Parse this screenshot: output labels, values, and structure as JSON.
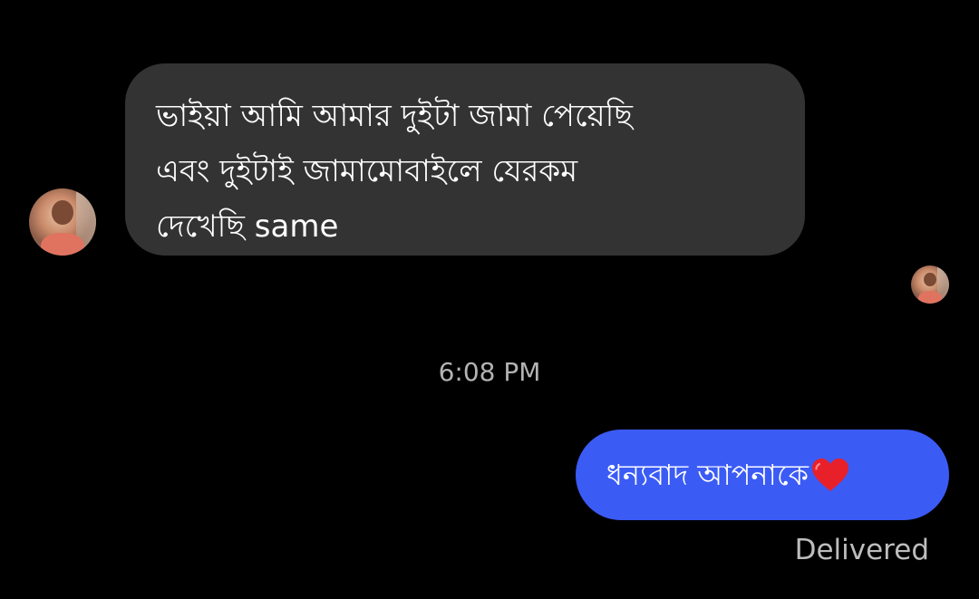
{
  "conversation": {
    "incoming_message": {
      "text": "ভাইয়া আমি আমার দুইটা জামা পেয়েছি\nএবং দুইটাই জামামোবাইলে যেরকম\nদেখেছি same",
      "bubble_color": "#333333",
      "sender_avatar_icon": "profile-photo"
    },
    "timestamp": "6:08 PM",
    "outgoing_message": {
      "text": "ধন্যবাদ আপনাকে",
      "emoji_icon": "red-heart-icon",
      "bubble_color": "#3b5bf5"
    },
    "status": "Delivered",
    "read_receipt_icon": "profile-photo"
  },
  "theme": {
    "background": "#000000",
    "text_primary": "#ffffff",
    "text_secondary": "#b3b3b3"
  }
}
